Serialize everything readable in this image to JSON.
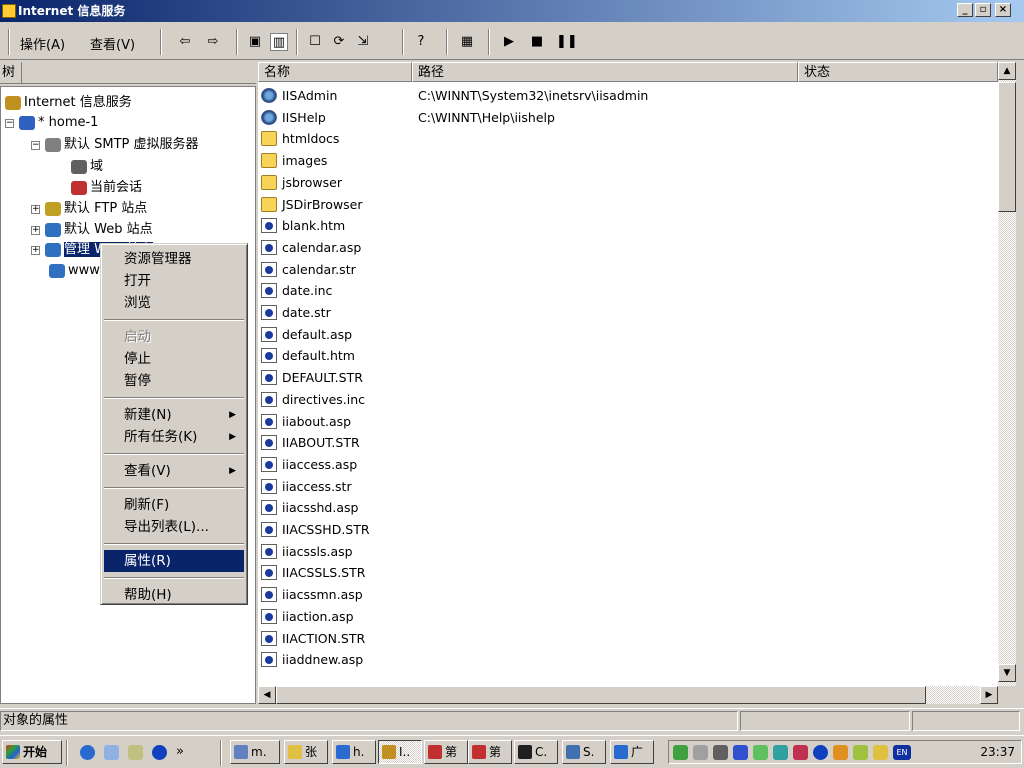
{
  "window": {
    "title": "Internet 信息服务",
    "controls": {
      "minimize": "_",
      "maximize": "▫",
      "close": "×"
    }
  },
  "menubar": {
    "items": [
      "操作(A)",
      "查看(V)"
    ]
  },
  "toolbar": {
    "icons": [
      "back-icon",
      "forward-icon",
      "up-folder-icon",
      "show-tree-icon",
      "properties-icon",
      "refresh-icon",
      "export-icon",
      "help-icon",
      "computer-icon",
      "play-icon",
      "stop-icon",
      "pause-icon"
    ],
    "glyphs": [
      "⇦",
      "⇨",
      "▣",
      "▥",
      "☐",
      "⟳",
      "⇲",
      "?",
      "▦",
      "▶",
      "■",
      "❚❚"
    ]
  },
  "tree": {
    "header": "树",
    "nodes": [
      {
        "label": "Internet 信息服务",
        "icon": "iis-icon"
      },
      {
        "label": "* home-1",
        "icon": "computer-icon"
      },
      {
        "label": "默认 SMTP 虚拟服务器",
        "icon": "smtp-icon"
      },
      {
        "label": "域",
        "icon": "domain-icon"
      },
      {
        "label": "当前会话",
        "icon": "session-icon"
      },
      {
        "label": "默认 FTP 站点",
        "icon": "ftp-icon"
      },
      {
        "label": "默认 Web 站点",
        "icon": "web-icon"
      },
      {
        "label": "管理 Web 站点",
        "icon": "web-icon"
      },
      {
        "label": "www",
        "icon": "web-icon"
      }
    ]
  },
  "list": {
    "columns": [
      "名称",
      "路径",
      "状态"
    ],
    "rows": [
      {
        "name": "IISAdmin",
        "path": "C:\\WINNT\\System32\\inetsrv\\iisadmin",
        "icon": "iis"
      },
      {
        "name": "IISHelp",
        "path": "C:\\WINNT\\Help\\iishelp",
        "icon": "iis"
      },
      {
        "name": "htmldocs",
        "path": "",
        "icon": "fold"
      },
      {
        "name": "images",
        "path": "",
        "icon": "fold"
      },
      {
        "name": "jsbrowser",
        "path": "",
        "icon": "fold"
      },
      {
        "name": "JSDirBrowser",
        "path": "",
        "icon": "fold"
      },
      {
        "name": "blank.htm",
        "path": "",
        "icon": "file"
      },
      {
        "name": "calendar.asp",
        "path": "",
        "icon": "file"
      },
      {
        "name": "calendar.str",
        "path": "",
        "icon": "file"
      },
      {
        "name": "date.inc",
        "path": "",
        "icon": "file"
      },
      {
        "name": "date.str",
        "path": "",
        "icon": "file"
      },
      {
        "name": "default.asp",
        "path": "",
        "icon": "file"
      },
      {
        "name": "default.htm",
        "path": "",
        "icon": "file"
      },
      {
        "name": "DEFAULT.STR",
        "path": "",
        "icon": "file"
      },
      {
        "name": "directives.inc",
        "path": "",
        "icon": "file"
      },
      {
        "name": "iiabout.asp",
        "path": "",
        "icon": "file"
      },
      {
        "name": "IIABOUT.STR",
        "path": "",
        "icon": "file"
      },
      {
        "name": "iiaccess.asp",
        "path": "",
        "icon": "file"
      },
      {
        "name": "iiaccess.str",
        "path": "",
        "icon": "file"
      },
      {
        "name": "iiacsshd.asp",
        "path": "",
        "icon": "file"
      },
      {
        "name": "IIACSSHD.STR",
        "path": "",
        "icon": "file"
      },
      {
        "name": "iiacssls.asp",
        "path": "",
        "icon": "file"
      },
      {
        "name": "IIACSSLS.STR",
        "path": "",
        "icon": "file"
      },
      {
        "name": "iiacssmn.asp",
        "path": "",
        "icon": "file"
      },
      {
        "name": "iiaction.asp",
        "path": "",
        "icon": "file"
      },
      {
        "name": "IIACTION.STR",
        "path": "",
        "icon": "file"
      },
      {
        "name": "iiaddnew.asp",
        "path": "",
        "icon": "file"
      }
    ]
  },
  "context_menu": {
    "items": [
      {
        "label": "资源管理器",
        "type": "item"
      },
      {
        "label": "打开",
        "type": "item"
      },
      {
        "label": "浏览",
        "type": "item"
      },
      {
        "type": "sep"
      },
      {
        "label": "启动",
        "type": "disabled"
      },
      {
        "label": "停止",
        "type": "item"
      },
      {
        "label": "暂停",
        "type": "item"
      },
      {
        "type": "sep"
      },
      {
        "label": "新建(N)",
        "type": "submenu"
      },
      {
        "label": "所有任务(K)",
        "type": "submenu"
      },
      {
        "type": "sep"
      },
      {
        "label": "查看(V)",
        "type": "submenu"
      },
      {
        "type": "sep"
      },
      {
        "label": "刷新(F)",
        "type": "item"
      },
      {
        "label": "导出列表(L)...",
        "type": "item"
      },
      {
        "type": "sep"
      },
      {
        "label": "属性(R)",
        "type": "selected"
      },
      {
        "type": "sep"
      },
      {
        "label": "帮助(H)",
        "type": "item"
      }
    ]
  },
  "statusbar": {
    "text": "对象的属性"
  },
  "taskbar": {
    "start": "开始",
    "quicklaunch_chevron": "»",
    "tasks": [
      "m.",
      "张",
      "h.",
      "I..",
      "第",
      "第",
      "C.",
      "S.",
      "广"
    ],
    "clock": "23:37",
    "ime": "EN"
  },
  "colors": {
    "selection": "#0a246a",
    "face": "#d4d0c8"
  }
}
